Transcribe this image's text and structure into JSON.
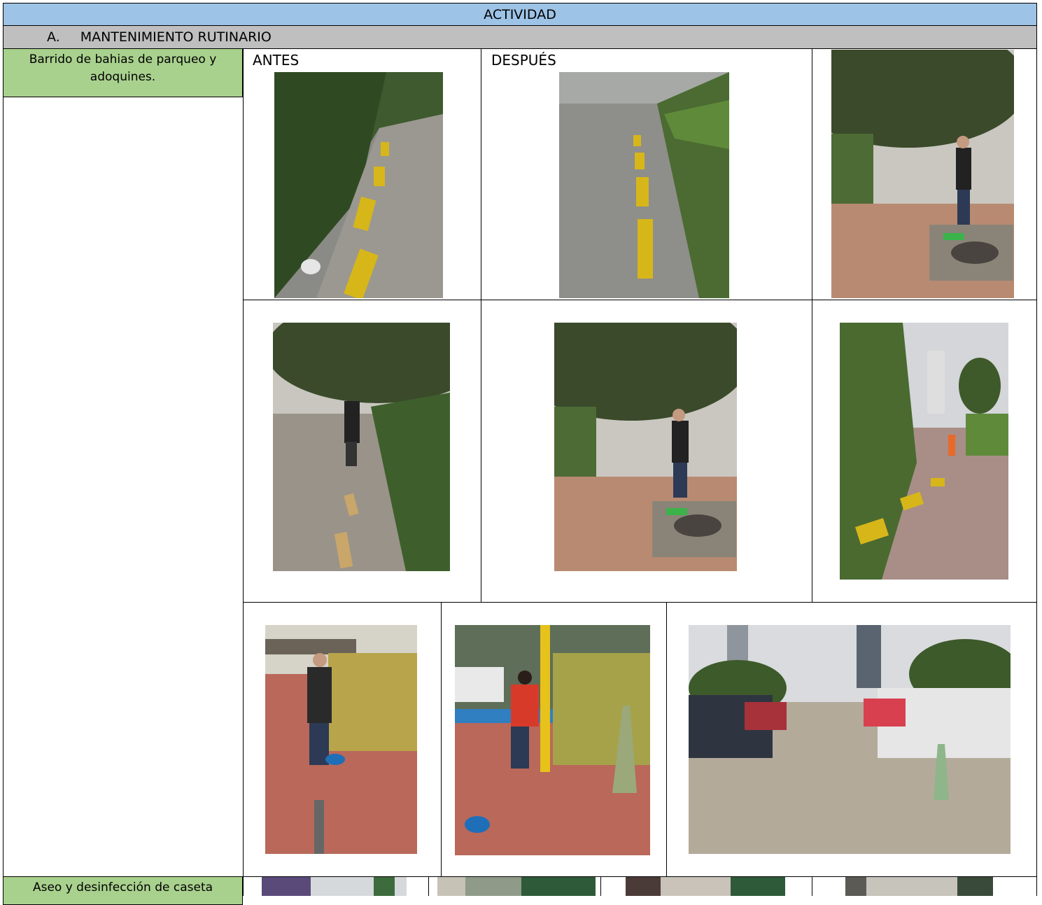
{
  "header": {
    "title": "ACTIVIDAD"
  },
  "section": {
    "number": "A.",
    "title": "MANTENIMIENTO RUTINARIO"
  },
  "activities": [
    {
      "label": "Barrido de bahias de parqueo y adoquines."
    },
    {
      "label": "Aseo y desinfección de caseta"
    }
  ],
  "columns": {
    "before": "ANTES",
    "after": "DESPUÉS"
  }
}
